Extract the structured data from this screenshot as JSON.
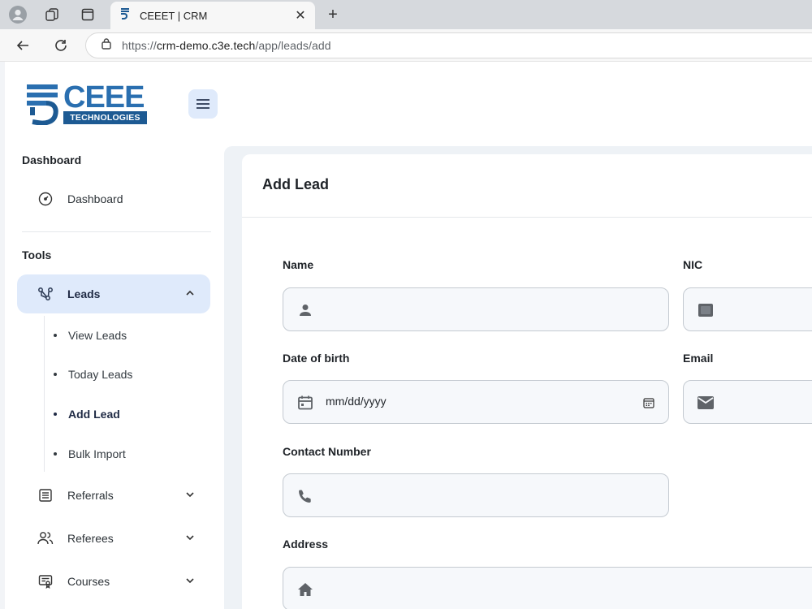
{
  "browser": {
    "tab_title": "CEEET | CRM",
    "tab_close": "✕",
    "new_tab": "+",
    "url_scheme": "https://",
    "url_host": "crm-demo.c3e.tech",
    "url_path": "/app/leads/add"
  },
  "logo": {
    "word": "CEEE",
    "sub": "TECHNOLOGIES"
  },
  "sidebar": {
    "section_dashboard": "Dashboard",
    "dashboard_item": "Dashboard",
    "section_tools": "Tools",
    "leads": "Leads",
    "leads_sub": [
      "View Leads",
      "Today Leads",
      "Add Lead",
      "Bulk Import"
    ],
    "referrals": "Referrals",
    "referees": "Referees",
    "courses": "Courses"
  },
  "form": {
    "title": "Add Lead",
    "name_label": "Name",
    "nic_label": "NIC",
    "dob_label": "Date of birth",
    "dob_placeholder": "mm/dd/yyyy",
    "email_label": "Email",
    "contact_label": "Contact Number",
    "address_label": "Address"
  },
  "colors": {
    "accent": "#2a6fb0",
    "active_bg": "#dfeafb",
    "content_bg": "#eef2f6"
  }
}
